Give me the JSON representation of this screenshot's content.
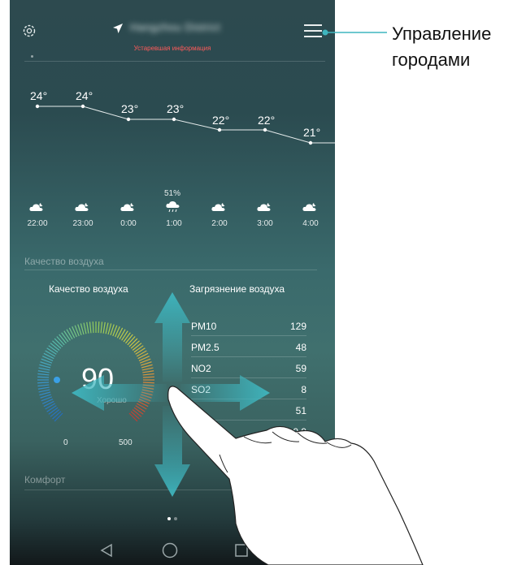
{
  "header": {
    "settings_icon": "gear-icon",
    "location_icon": "location-arrow-icon",
    "city_name": "Hangzhou District",
    "outdated_notice": "Устаревшая информация",
    "menu_icon": "hamburger-menu-icon"
  },
  "hourly_forecast": {
    "temperatures": [
      "24°",
      "24°",
      "23°",
      "23°",
      "22°",
      "22°",
      "21°"
    ],
    "precipitation": "51%",
    "hours": [
      "22:00",
      "23:00",
      "0:00",
      "1:00",
      "2:00",
      "3:00",
      "4:00"
    ],
    "weather_icons": [
      "partly-cloudy-night-icon",
      "partly-cloudy-night-icon",
      "partly-cloudy-night-icon",
      "rain-cloud-icon",
      "partly-cloudy-night-icon",
      "partly-cloudy-night-icon",
      "partly-cloudy-night-icon"
    ]
  },
  "air_quality": {
    "section_title": "Качество воздуха",
    "gauge_title": "Качество воздуха",
    "aqi_value": "90",
    "aqi_level": "Хорошо",
    "scale_min": "0",
    "scale_max": "500",
    "pollution_title": "Загрязнение воздуха",
    "pollutants": [
      {
        "name": "PM10",
        "value": "129"
      },
      {
        "name": "PM2.5",
        "value": "48"
      },
      {
        "name": "NO2",
        "value": "59"
      },
      {
        "name": "SO2",
        "value": "8"
      },
      {
        "name": "",
        "value": "51"
      },
      {
        "name": "CO",
        "value": "0.9"
      }
    ]
  },
  "comfort": {
    "section_title": "Комфорт"
  },
  "pager": {
    "count": 2,
    "active": 1
  },
  "navbar": {
    "back_icon": "back-triangle-icon",
    "home_icon": "home-circle-icon",
    "recents_icon": "recents-square-icon"
  },
  "annotation": {
    "callout_line1": "Управление",
    "callout_line2": "городами"
  },
  "colors": {
    "outdated": "#ff5a5a",
    "gesture_arrow": "#3fb6bf",
    "callout_line": "#3fb6bf"
  }
}
